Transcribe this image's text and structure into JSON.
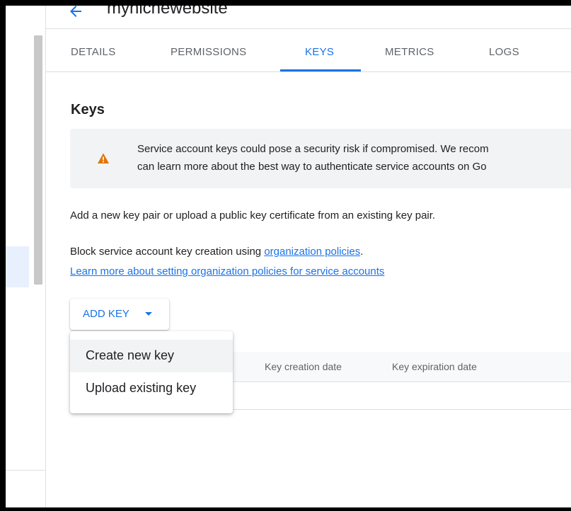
{
  "header": {
    "title": "mynichewebsite"
  },
  "tabs": [
    {
      "label": "DETAILS",
      "active": false
    },
    {
      "label": "PERMISSIONS",
      "active": false
    },
    {
      "label": "KEYS",
      "active": true
    },
    {
      "label": "METRICS",
      "active": false
    },
    {
      "label": "LOGS",
      "active": false
    }
  ],
  "keys": {
    "title": "Keys",
    "warning": {
      "line1": "Service account keys could pose a security risk if compromised. We recom",
      "line2": "can learn more about the best way to authenticate service accounts on Go",
      "icon": "warning-triangle-icon",
      "icon_color": "#e37400"
    },
    "intro": "Add a new key pair or upload a public key certificate from an existing key pair.",
    "block_text": "Block service account key creation using ",
    "block_link": "organization policies",
    "block_suffix": ".",
    "learn_more_link": "Learn more about setting organization policies for service accounts",
    "add_key_label": "ADD KEY",
    "menu": {
      "create": "Create new key",
      "upload": "Upload existing key"
    },
    "table": {
      "col_creation": "Key creation date",
      "col_expiration": "Key expiration date"
    }
  },
  "colors": {
    "accent": "#1a73e8",
    "warning": "#e37400"
  }
}
